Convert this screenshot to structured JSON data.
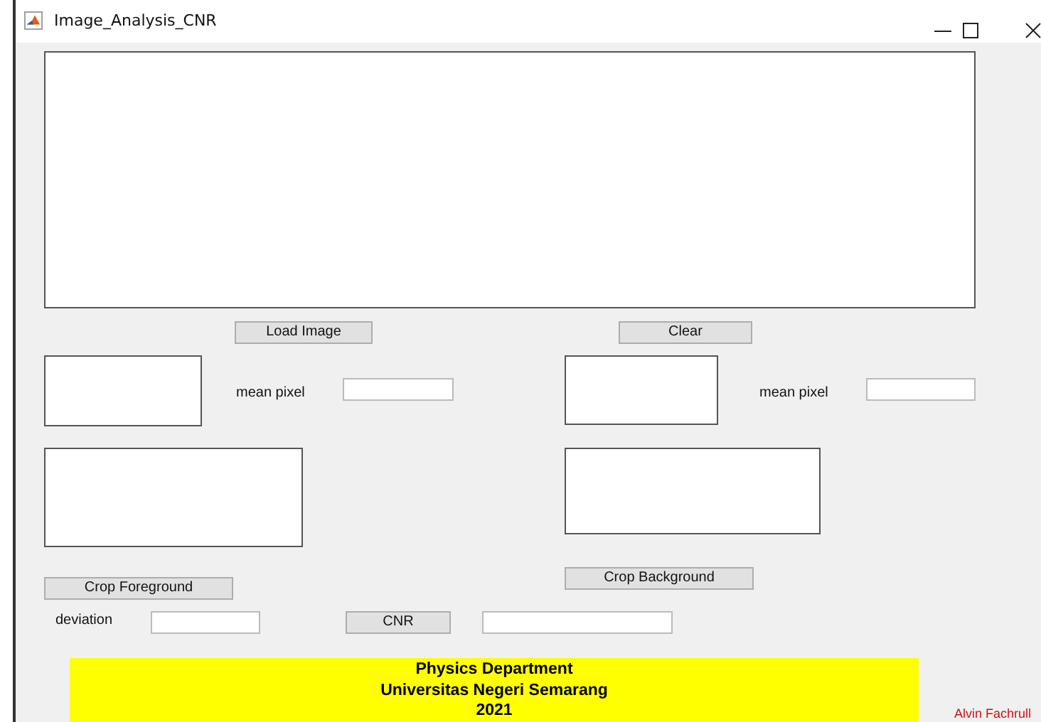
{
  "window": {
    "title": "Image_Analysis_CNR"
  },
  "load_button": {
    "label": "Load Image"
  },
  "clear_button": {
    "label": "Clear"
  },
  "foreground": {
    "mean_label": "mean pixel",
    "crop_button": "Crop Foreground"
  },
  "background": {
    "mean_label": "mean pixel",
    "crop_button": "Crop Background"
  },
  "deviation_label": "deviation",
  "cnr_button": {
    "label": "CNR"
  },
  "banner": {
    "lines": [
      "Physics Department",
      "Universitas Negeri Semarang",
      "2021"
    ]
  },
  "author": "Alvin Fachrull"
}
